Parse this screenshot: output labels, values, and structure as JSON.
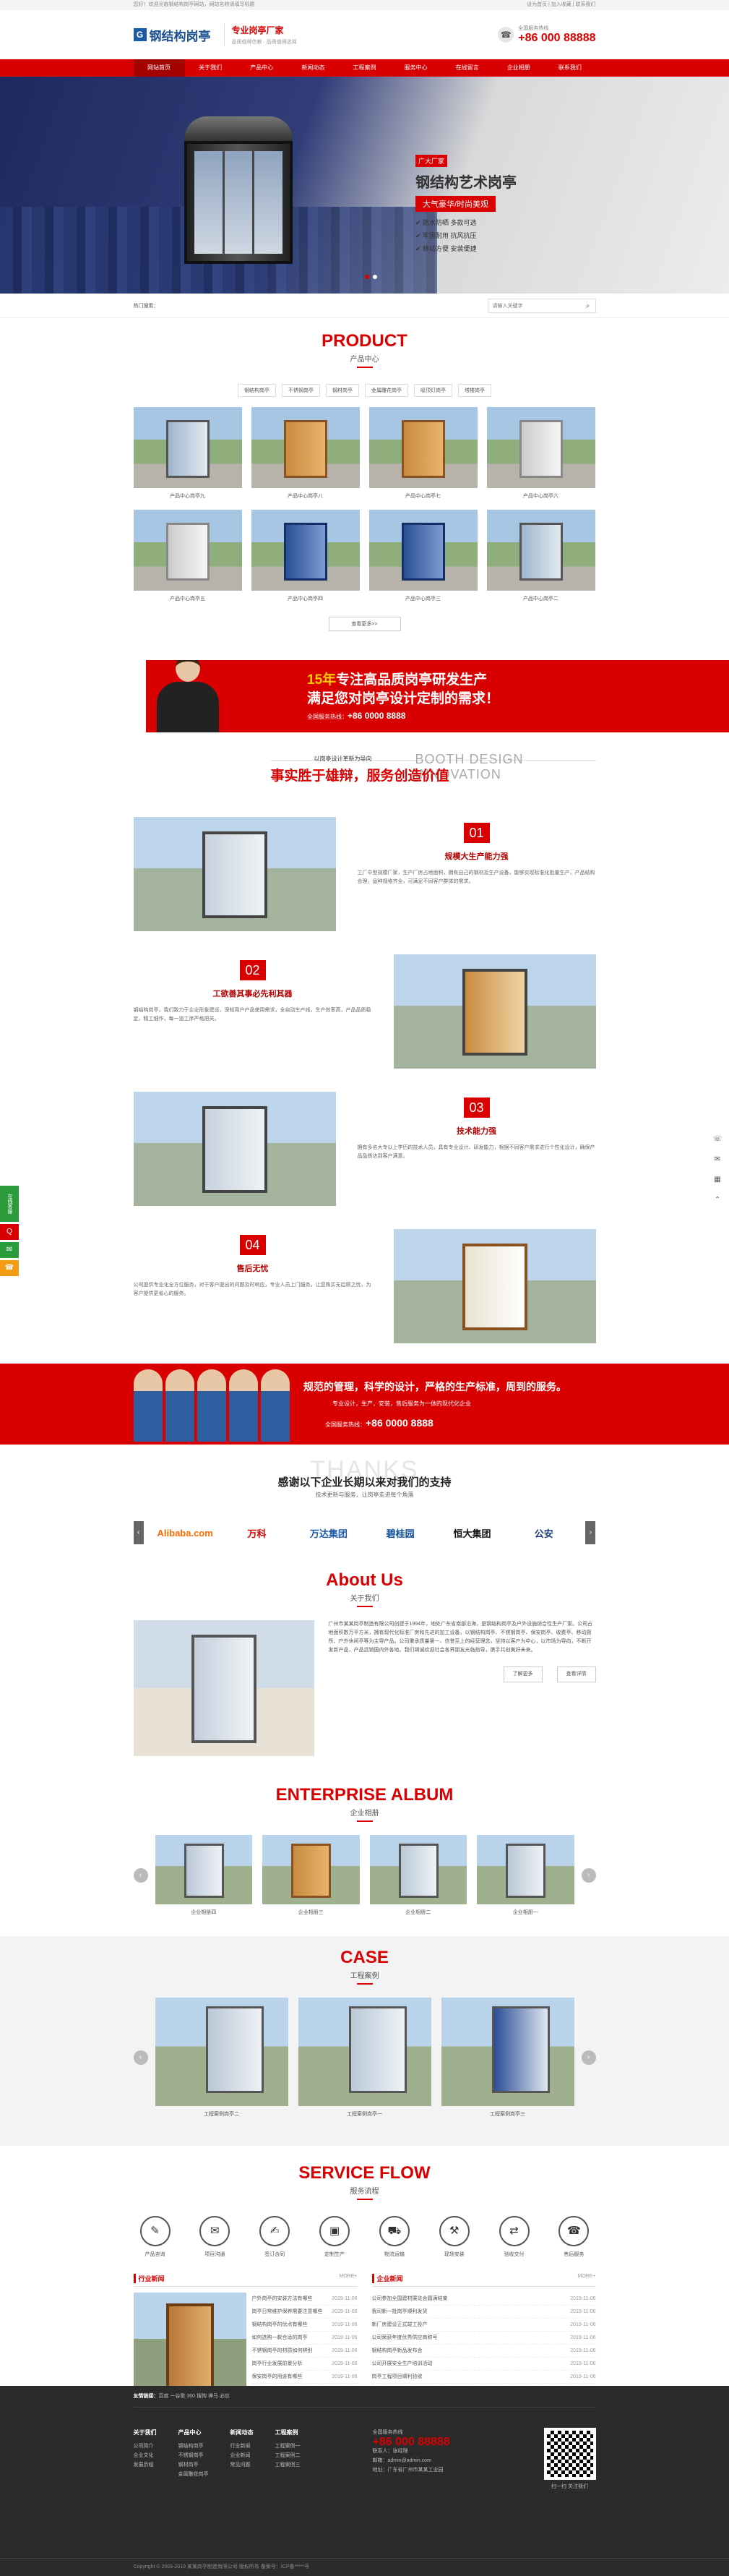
{
  "topbar": {
    "left": "您好！欢迎光临钢结构岗亭网站，网站名称请填写标题",
    "right": "设为首页 | 加入收藏 | 联系我们"
  },
  "header": {
    "logo_mark": "G",
    "logo_text": "钢结构岗亭",
    "slogan_main": "专业岗亭厂家",
    "slogan_sub": "品质值得信赖 · 品质值得选择",
    "hotline_label": "全国服务热线",
    "hotline": "+86 000 88888",
    "phone_icon": "phone-icon"
  },
  "nav": [
    "网站首页",
    "关于我们",
    "产品中心",
    "新闻动态",
    "工程案例",
    "服务中心",
    "在线留言",
    "企业相册",
    "联系我们"
  ],
  "banner": {
    "tag": "广大厂家",
    "title": "钢结构艺术岗亭",
    "ribbon": "大气豪华/时尚美观",
    "points": [
      "防水防晒 多款可选",
      "牢固耐用 抗风抗压",
      "移动方便 安装便捷"
    ]
  },
  "search": {
    "hot": "热门搜索：",
    "placeholder": "请输入关键字",
    "icon": "search-icon"
  },
  "product": {
    "en": "PRODUCT",
    "cn": "产品中心",
    "tabs": [
      "钢结构岗亭",
      "不锈钢岗亭",
      "钢材岗亭",
      "金属雕花岗亭",
      "吸顶灯岗亭",
      "塔楼岗亭"
    ],
    "items": [
      "产品中心岗亭九",
      "产品中心岗亭八",
      "产品中心岗亭七",
      "产品中心岗亭六",
      "产品中心岗亭五",
      "产品中心岗亭四",
      "产品中心岗亭三",
      "产品中心岗亭二"
    ],
    "more": "查看更多>>"
  },
  "promo": {
    "years": "15年",
    "line1_rest": "专注高品质岗亭研发生产",
    "line2": "满足您对岗亭设计定制的需求！",
    "hotline_label": "全国服务热线：",
    "hotline": "+86 0000 8888"
  },
  "advantages": {
    "small": "以岗亭设计革新为导向",
    "en": "BOOTH DESIGN INNOVATION",
    "big": "事实胜于雄辩，服务创造价值",
    "items": [
      {
        "num": "01",
        "title": "规模大生产能力强",
        "text": "工厂中型规模厂家，生产厂房占地面积，拥有自己的钢材及生产设备，能够实现标准化批量生产，产品结构合理，品种规格齐全，可满足不同客户群体的需求。"
      },
      {
        "num": "02",
        "title": "工欲善其事必先利其器",
        "text": "钢结构岗亭，我们致力于企业形象建设，深知用户产品使用需求，全自动生产线，生产效率高，产品品质稳定，精工细作，每一道工序严格把关。"
      },
      {
        "num": "03",
        "title": "技术能力强",
        "text": "拥有多名大专以上学历的技术人员，具有专业设计、研发能力，根据不同客户需求进行个性化设计，确保产品品质达到客户满意。"
      },
      {
        "num": "04",
        "title": "售后无忧",
        "text": "公司提供专业化全方位服务，对于客户提出的问题及时响应，专业人员上门服务，让您购买无后顾之忧，为客户提供更省心的服务。"
      }
    ]
  },
  "promo2": {
    "words": [
      "规范",
      "科学",
      "严格",
      "周到"
    ],
    "line1": "规范的管理，科学的设计，严格的生产标准，周到的服务。",
    "line2": "专业设计，生产，安装，售后服务为一体的现代化企业",
    "hotline_label": "全国服务热线：",
    "hotline": "+86 0000 8888"
  },
  "partners": {
    "en": "THANKS",
    "cn": "感谢以下企业长期以来对我们的支持",
    "sub": "技术更新与服务，让岗亭走进每个角落",
    "logos": [
      "Alibaba.com",
      "万科",
      "万达集团",
      "碧桂园",
      "恒大集团",
      "公安"
    ]
  },
  "about": {
    "en": "About Us",
    "cn": "关于我们",
    "text": "广州市某某岗亭制造有限公司创建于1994年，地处广东省南部沿海，是钢结构岗亭及户外设施综合性生产厂家。公司占地面积数万平方米，拥有现代化标准厂房和先进的加工设备，以钢结构岗亭、不锈钢岗亭、保安岗亭、收费亭、移动厕所、户外休闲亭等为主导产品。公司秉承质量第一、信誉至上的经营理念，坚持以客户为中心，以市场为导向，不断开发新产品，产品远销国内外各地。我们竭诚欢迎社会各界朋友光临指导，携手共创美好未来。",
    "btn1": "了解更多",
    "btn2": "查看详情"
  },
  "album": {
    "en": "ENTERPRISE ALBUM",
    "cn": "企业相册",
    "items": [
      "企业相册四",
      "企业相册三",
      "企业相册二",
      "企业相册一"
    ]
  },
  "case": {
    "en": "CASE",
    "cn": "工程案例",
    "items": [
      "工程案例岗亭二",
      "工程案例岗亭一",
      "工程案例岗亭三"
    ]
  },
  "flow": {
    "en": "SERVICE FLOW",
    "cn": "服务流程",
    "steps": [
      {
        "label": "产品咨询",
        "icon": "consult-icon"
      },
      {
        "label": "项目沟通",
        "icon": "chat-icon"
      },
      {
        "label": "签订合同",
        "icon": "contract-icon"
      },
      {
        "label": "定制生产",
        "icon": "box-icon"
      },
      {
        "label": "物流运输",
        "icon": "truck-icon"
      },
      {
        "label": "现场安装",
        "icon": "install-icon"
      },
      {
        "label": "验收交付",
        "icon": "exchange-icon"
      },
      {
        "label": "售后服务",
        "icon": "service-icon"
      }
    ]
  },
  "news": {
    "industry": {
      "title": "行业新闻",
      "more": "MORE+",
      "items": [
        {
          "t": "户外岗亭的安装方法有哪些",
          "d": "2019-11-06"
        },
        {
          "t": "岗亭日常维护保养需要注意哪些",
          "d": "2019-11-06"
        },
        {
          "t": "钢结构岗亭的优点有哪些",
          "d": "2019-11-06"
        },
        {
          "t": "如何选购一款合适的岗亭",
          "d": "2019-11-06"
        },
        {
          "t": "不锈钢岗亭的材质如何辨别",
          "d": "2019-11-06"
        },
        {
          "t": "岗亭行业发展前景分析",
          "d": "2019-11-06"
        },
        {
          "t": "保安岗亭的用途有哪些",
          "d": "2019-11-06"
        },
        {
          "t": "移动岗亭运输注意事项",
          "d": "2019-11-06"
        },
        {
          "t": "岗亭定制需要提供哪些资料",
          "d": "2019-11-06"
        }
      ]
    },
    "company": {
      "title": "企业新闻",
      "more": "MORE+",
      "items": [
        {
          "t": "公司参加全国建材展览会圆满结束",
          "d": "2019-11-06"
        },
        {
          "t": "我司新一批岗亭顺利发货",
          "d": "2019-11-06"
        },
        {
          "t": "新厂房建设正式竣工投产",
          "d": "2019-11-06"
        },
        {
          "t": "公司荣获年度优秀供应商称号",
          "d": "2019-11-06"
        },
        {
          "t": "钢结构岗亭新品发布会",
          "d": "2019-11-06"
        },
        {
          "t": "公司开展安全生产培训活动",
          "d": "2019-11-06"
        },
        {
          "t": "岗亭工程项目顺利验收",
          "d": "2019-11-06"
        },
        {
          "t": "热烈欢迎客户莅临参观",
          "d": "2019-11-06"
        },
        {
          "t": "公司年度总结表彰大会召开",
          "d": "2019-11-06"
        }
      ]
    }
  },
  "footer": {
    "links_label": "友情链接：",
    "links": "百度   一谷歌   360   搜狗   神马   必应",
    "cols": [
      {
        "title": "关于我们",
        "items": [
          "公司简介",
          "企业文化",
          "发展历程"
        ]
      },
      {
        "title": "产品中心",
        "items": [
          "钢结构岗亭",
          "不锈钢岗亭",
          "钢材岗亭",
          "金属雕花岗亭"
        ]
      },
      {
        "title": "新闻动态",
        "items": [
          "行业新闻",
          "企业新闻",
          "常见问题"
        ]
      },
      {
        "title": "工程案例",
        "items": [
          "工程案例一",
          "工程案例二",
          "工程案例三"
        ]
      }
    ],
    "contact_label": "全国服务热线",
    "contact_phone": "+86 000 88888",
    "contact_lines": [
      "联系人：张经理",
      "邮箱：admin@admin.com",
      "地址：广东省广州市某某工业园"
    ],
    "qr_label": "扫一扫 关注我们",
    "copy": "Copyright © 2009-2019 某某岗亭制造有限公司 版权所有   备案号：ICP备*****号"
  },
  "float_left": {
    "label": "在线客服",
    "icons": [
      "qq-icon",
      "wechat-icon",
      "phone-icon"
    ]
  },
  "float_right": {
    "icons": [
      "phone-icon",
      "chat-icon",
      "qrcode-icon",
      "top-icon"
    ]
  }
}
